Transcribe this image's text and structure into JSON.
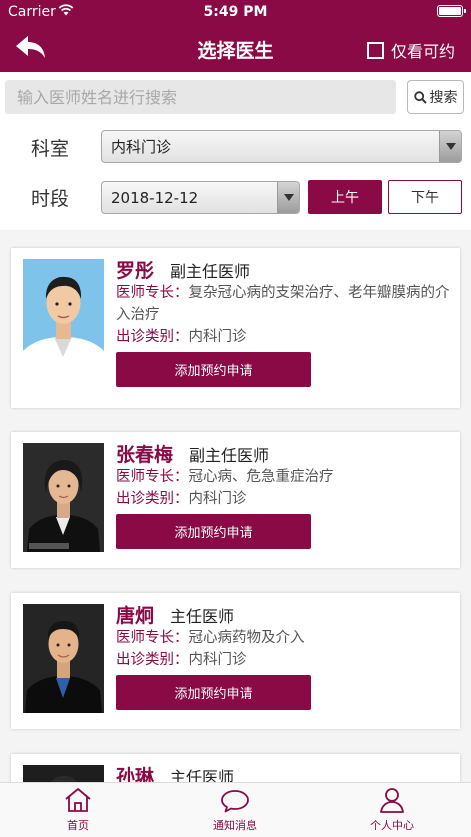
{
  "status_bar": {
    "carrier": "Carrier",
    "time": "5:49 PM"
  },
  "header": {
    "title": "选择医生",
    "only_available_label": "仅看可约"
  },
  "search": {
    "placeholder": "输入医师姓名进行搜索",
    "button_label": "搜索"
  },
  "filters": {
    "department_label": "科室",
    "department_value": "内科门诊",
    "period_label": "时段",
    "date_value": "2018-12-12",
    "morning_label": "上午",
    "afternoon_label": "下午",
    "selected_period": "上午"
  },
  "doctors": [
    {
      "name": "罗彤",
      "title": "副主任医师",
      "specialty_key": "医师专长：",
      "specialty": "复杂冠心病的支架治疗、老年瓣膜病的介入治疗",
      "visit_key": "出诊类别：",
      "visit_type": "内科门诊",
      "apply_label": "添加预约申请"
    },
    {
      "name": "张春梅",
      "title": "副主任医师",
      "specialty_key": "医师专长：",
      "specialty": "冠心病、危急重症治疗",
      "visit_key": "出诊类别：",
      "visit_type": "内科门诊",
      "apply_label": "添加预约申请"
    },
    {
      "name": "唐炯",
      "title": "主任医师",
      "specialty_key": "医师专长：",
      "specialty": "冠心病药物及介入",
      "visit_key": "出诊类别：",
      "visit_type": "内科门诊",
      "apply_label": "添加预约申请"
    },
    {
      "name": "孙琳",
      "title": "主任医师"
    }
  ],
  "tabbar": {
    "home": "首页",
    "notifications": "通知消息",
    "profile": "个人中心"
  },
  "colors": {
    "brand": "#8a0a45",
    "background": "#f4f4f4"
  }
}
